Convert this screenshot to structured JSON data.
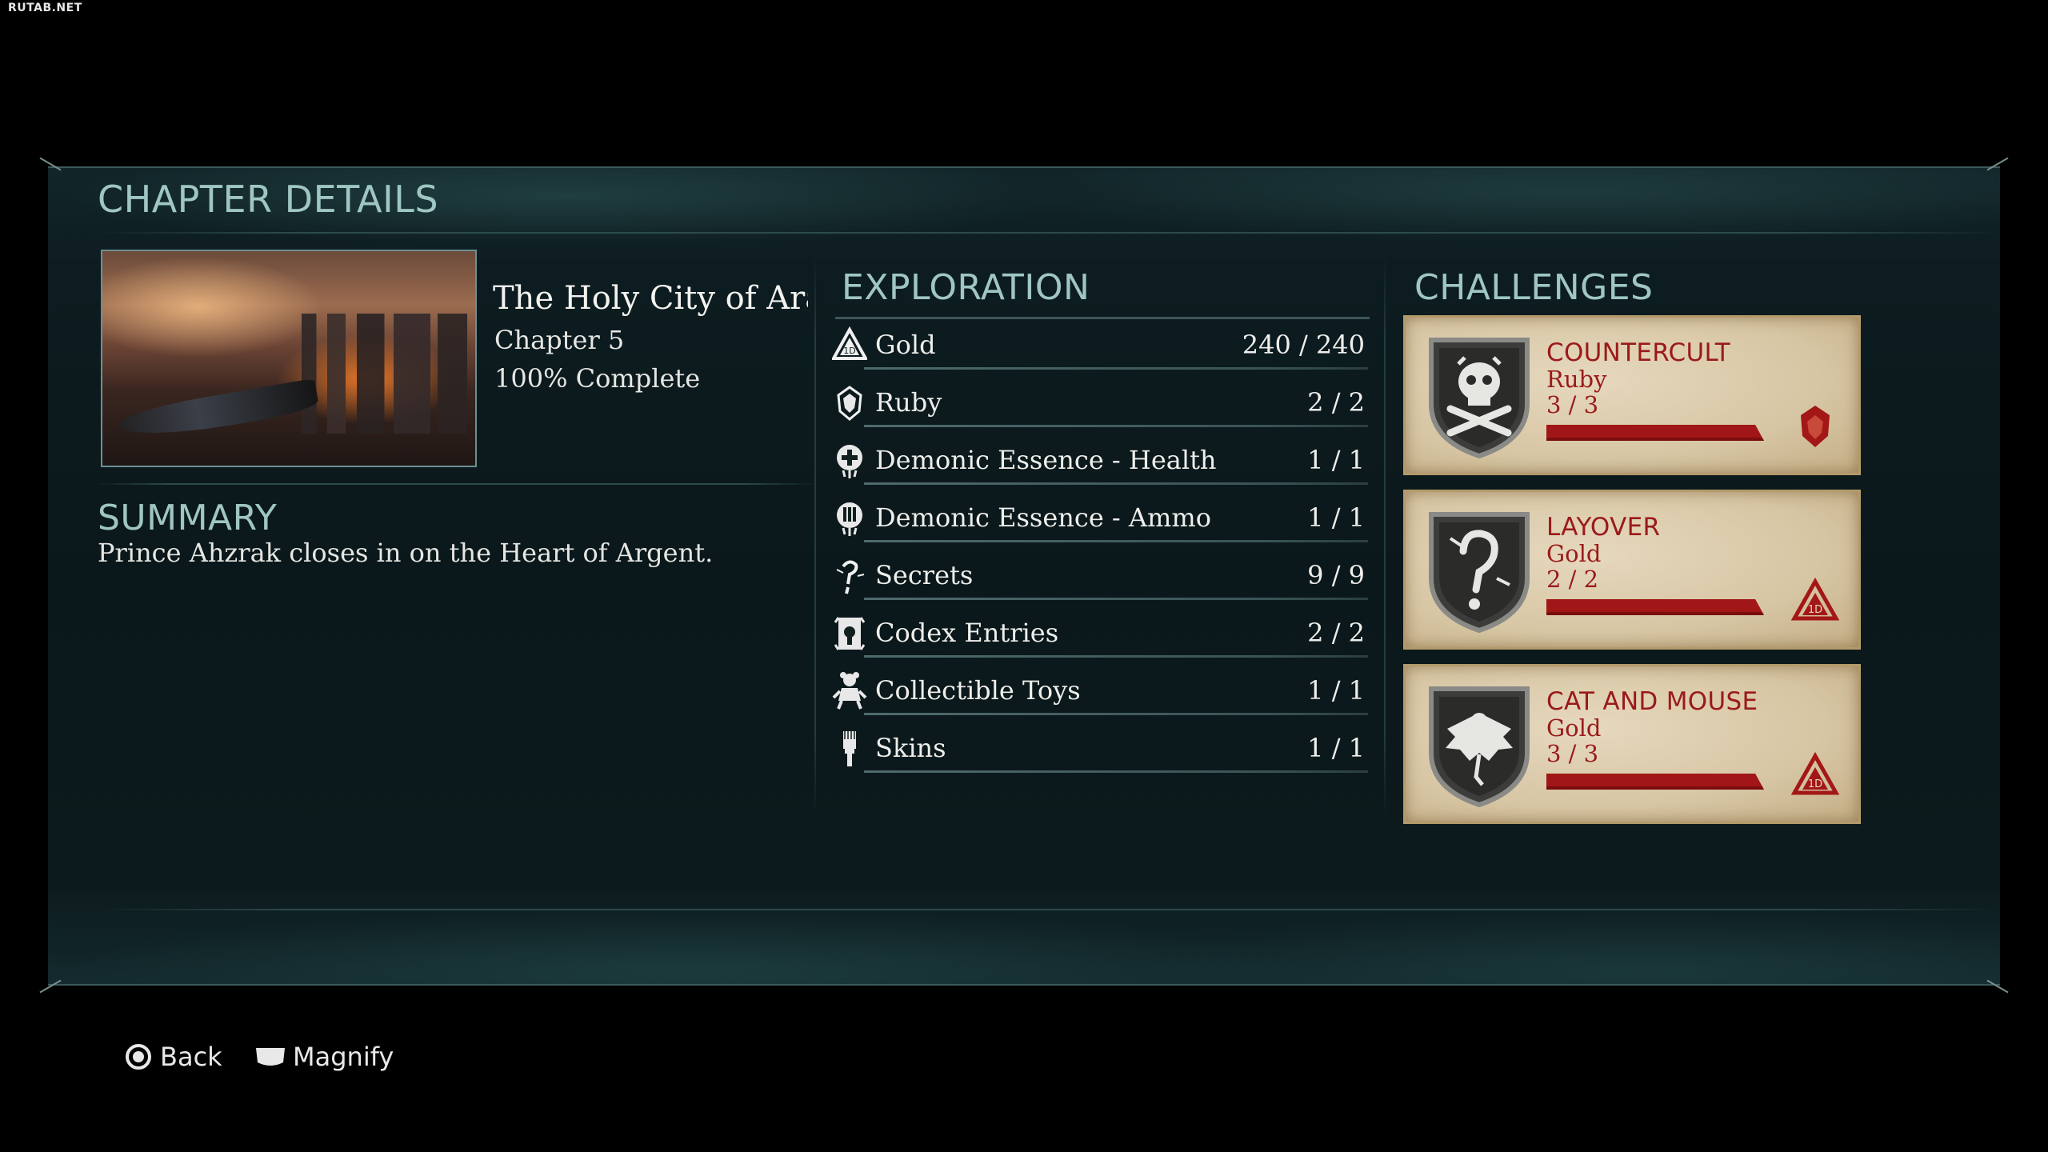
{
  "watermark": "RUTAB.NET",
  "panel_title": "CHAPTER DETAILS",
  "chapter": {
    "title": "The Holy City of Ara",
    "number": "Chapter 5",
    "completion": "100% Complete"
  },
  "summary": {
    "heading": "SUMMARY",
    "text": "Prince Ahzrak closes in on the Heart of Argent."
  },
  "exploration": {
    "heading": "EXPLORATION",
    "items": [
      {
        "label": "Gold",
        "value": "240 / 240",
        "icon": "gold-triangle-icon"
      },
      {
        "label": "Ruby",
        "value": "2 / 2",
        "icon": "ruby-icon"
      },
      {
        "label": "Demonic Essence - Health",
        "value": "1 / 1",
        "icon": "health-essence-icon"
      },
      {
        "label": "Demonic Essence - Ammo",
        "value": "1 / 1",
        "icon": "ammo-essence-icon"
      },
      {
        "label": "Secrets",
        "value": "9 / 9",
        "icon": "secrets-icon"
      },
      {
        "label": "Codex Entries",
        "value": "2 / 2",
        "icon": "codex-icon"
      },
      {
        "label": "Collectible Toys",
        "value": "1 / 1",
        "icon": "toy-icon"
      },
      {
        "label": "Skins",
        "value": "1 / 1",
        "icon": "skin-brush-icon"
      }
    ]
  },
  "challenges": {
    "heading": "CHALLENGES",
    "items": [
      {
        "name": "COUNTERCULT",
        "reward": "Ruby",
        "progress": "3 / 3",
        "progress_fraction": 1.0,
        "badge_icon": "skull-crossbones-icon",
        "reward_icon": "ruby-icon"
      },
      {
        "name": "LAYOVER",
        "reward": "Gold",
        "progress": "2 / 2",
        "progress_fraction": 1.0,
        "badge_icon": "question-mark-icon",
        "reward_icon": "gold-triangle-icon"
      },
      {
        "name": "CAT AND MOUSE",
        "reward": "Gold",
        "progress": "3 / 3",
        "progress_fraction": 1.0,
        "badge_icon": "winged-demon-icon",
        "reward_icon": "gold-triangle-icon"
      }
    ]
  },
  "footer": {
    "back_label": "Back",
    "magnify_label": "Magnify"
  },
  "colors": {
    "accent_heading": "#9fc6c2",
    "challenge_red": "#9a1a1a",
    "parchment": "#d7c6a4"
  }
}
